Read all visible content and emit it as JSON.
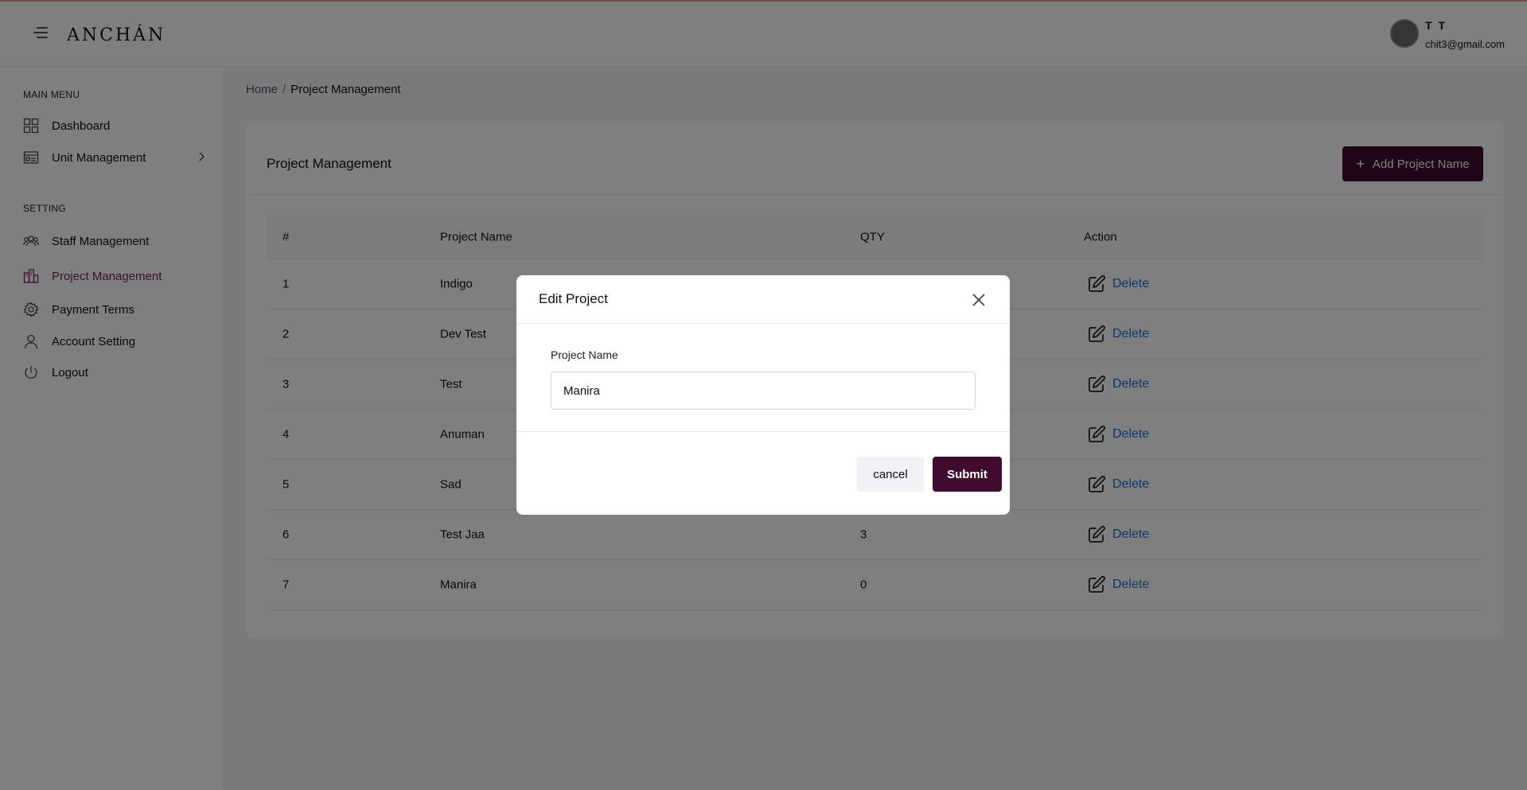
{
  "header": {
    "logo": "ANCHÁN",
    "user_name": "T T",
    "user_email": "chit3@gmail.com"
  },
  "sidebar": {
    "main_menu_heading": "MAIN MENU",
    "setting_heading": "SETTING",
    "items": [
      {
        "label": "Dashboard",
        "icon": "dashboard-icon"
      },
      {
        "label": "Unit Management",
        "icon": "unit-icon"
      },
      {
        "label": "Staff Management",
        "icon": "staff-icon"
      },
      {
        "label": "Project Management",
        "icon": "project-icon",
        "active": true
      },
      {
        "label": "Payment Terms",
        "icon": "gear-icon"
      },
      {
        "label": "Account Setting",
        "icon": "user-icon"
      },
      {
        "label": "Logout",
        "icon": "power-icon"
      }
    ]
  },
  "breadcrumb": {
    "home": "Home",
    "separator": "/",
    "current": "Project Management"
  },
  "card": {
    "title": "Project Management",
    "add_button": "Add Project Name",
    "add_icon": "+"
  },
  "table": {
    "headers": [
      "#",
      "Project Name",
      "QTY",
      "Action"
    ],
    "delete_label": "Delete",
    "rows": [
      {
        "no": "1",
        "name": "Indigo",
        "qty": ""
      },
      {
        "no": "2",
        "name": "Dev Test",
        "qty": ""
      },
      {
        "no": "3",
        "name": "Test",
        "qty": ""
      },
      {
        "no": "4",
        "name": "Anuman",
        "qty": ""
      },
      {
        "no": "5",
        "name": "Sad",
        "qty": ""
      },
      {
        "no": "6",
        "name": "Test Jaa",
        "qty": "3"
      },
      {
        "no": "7",
        "name": "Manira",
        "qty": "0"
      }
    ]
  },
  "modal": {
    "title": "Edit Project",
    "field_label": "Project Name",
    "field_value": "Manira",
    "cancel_label": "cancel",
    "submit_label": "Submit"
  },
  "colors": {
    "brand": "#3f0b2f",
    "active_nav": "#7a1e5a",
    "link": "#1d6fd6"
  }
}
